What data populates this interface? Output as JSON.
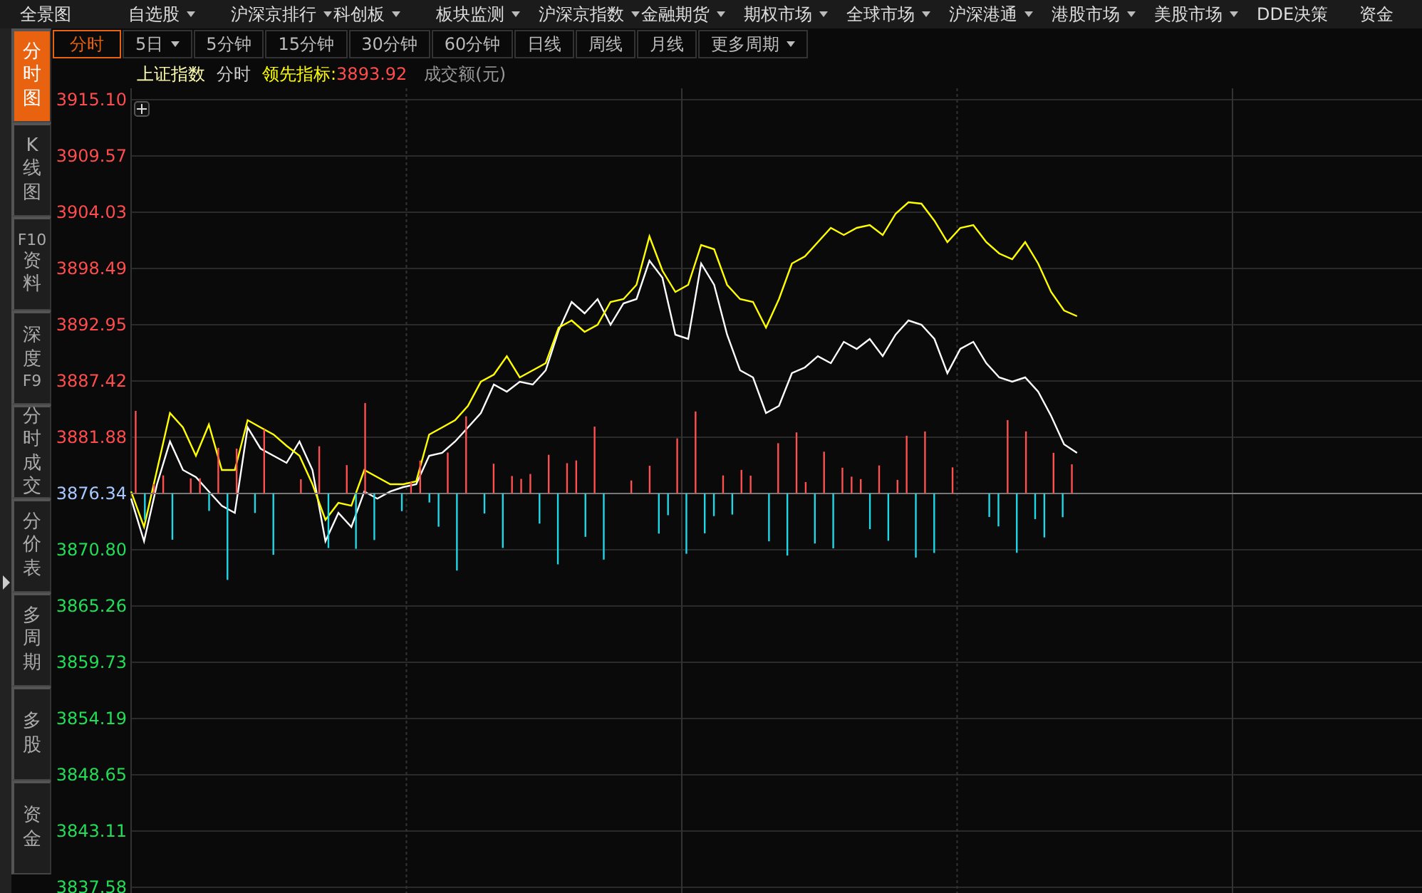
{
  "menu": [
    {
      "label": "全景图",
      "dropdown": false
    },
    {
      "label": "自选股",
      "dropdown": true
    },
    {
      "label": "沪深京排行",
      "dropdown": true
    },
    {
      "label": "科创板",
      "dropdown": true
    },
    {
      "label": "板块监测",
      "dropdown": true
    },
    {
      "label": "沪深京指数",
      "dropdown": true
    },
    {
      "label": "金融期货",
      "dropdown": true
    },
    {
      "label": "期权市场",
      "dropdown": true
    },
    {
      "label": "全球市场",
      "dropdown": true
    },
    {
      "label": "沪深港通",
      "dropdown": true
    },
    {
      "label": "港股市场",
      "dropdown": true
    },
    {
      "label": "美股市场",
      "dropdown": true
    },
    {
      "label": "DDE决策",
      "dropdown": false
    },
    {
      "label": "资金",
      "dropdown": false
    }
  ],
  "sidebar": [
    {
      "lines": [
        "分",
        "时",
        "图"
      ],
      "selected": true
    },
    {
      "lines": [
        "K",
        "线",
        "图"
      ],
      "selected": false
    },
    {
      "lines": [
        "F10",
        "资",
        "料"
      ],
      "selected": false
    },
    {
      "lines": [
        "深",
        "度",
        "F9"
      ],
      "selected": false
    },
    {
      "lines": [
        "分",
        "时",
        "成",
        "交"
      ],
      "selected": false
    },
    {
      "lines": [
        "分",
        "价",
        "表"
      ],
      "selected": false
    },
    {
      "lines": [
        "多",
        "周",
        "期"
      ],
      "selected": false
    },
    {
      "lines": [
        "多",
        "股"
      ],
      "selected": false
    },
    {
      "lines": [
        "资",
        "金"
      ],
      "selected": false
    }
  ],
  "periods": [
    {
      "label": "分时",
      "dropdown": false,
      "selected": true
    },
    {
      "label": "5日",
      "dropdown": true,
      "selected": false
    },
    {
      "label": "5分钟",
      "dropdown": false,
      "selected": false
    },
    {
      "label": "15分钟",
      "dropdown": false,
      "selected": false
    },
    {
      "label": "30分钟",
      "dropdown": false,
      "selected": false
    },
    {
      "label": "60分钟",
      "dropdown": false,
      "selected": false
    },
    {
      "label": "日线",
      "dropdown": false,
      "selected": false
    },
    {
      "label": "周线",
      "dropdown": false,
      "selected": false
    },
    {
      "label": "月线",
      "dropdown": false,
      "selected": false
    },
    {
      "label": "更多周期",
      "dropdown": true,
      "selected": false
    }
  ],
  "info": {
    "title": "上证指数",
    "period": "分时",
    "indicator_label": "领先指标:",
    "indicator_value": "3893.92",
    "volume_label": "成交额(元)"
  },
  "chart_data": {
    "type": "line",
    "grid": true,
    "ylim": [
      3837.58,
      3915.1
    ],
    "yticks": [
      {
        "value": 3915.1,
        "label": "3915.10"
      },
      {
        "value": 3909.57,
        "label": "3909.57"
      },
      {
        "value": 3904.03,
        "label": "3904.03"
      },
      {
        "value": 3898.49,
        "label": "3898.49"
      },
      {
        "value": 3892.95,
        "label": "3892.95"
      },
      {
        "value": 3887.42,
        "label": "3887.42"
      },
      {
        "value": 3881.88,
        "label": "3881.88"
      },
      {
        "value": 3876.34,
        "label": "3876.34"
      },
      {
        "value": 3870.8,
        "label": "3870.80"
      },
      {
        "value": 3865.26,
        "label": "3865.26"
      },
      {
        "value": 3859.73,
        "label": "3859.73"
      },
      {
        "value": 3854.19,
        "label": "3854.19"
      },
      {
        "value": 3848.65,
        "label": "3848.65"
      },
      {
        "value": 3843.11,
        "label": "3843.11"
      },
      {
        "value": 3837.58,
        "label": "3837.58"
      }
    ],
    "categories": [
      null,
      null,
      null,
      null,
      null,
      null,
      null,
      null,
      null,
      null,
      null,
      null,
      null,
      null,
      null,
      null,
      null,
      null,
      null,
      null,
      null,
      null,
      null,
      null,
      null,
      null,
      null,
      null,
      null,
      null,
      null,
      null,
      null,
      null,
      null,
      null,
      null,
      null,
      null,
      null,
      null,
      null,
      null,
      null,
      null,
      null,
      null,
      null,
      null,
      null,
      null,
      null,
      null,
      null,
      null,
      null,
      null,
      null,
      null,
      null,
      null,
      null,
      null,
      null,
      null,
      null,
      null,
      null,
      null,
      null,
      null,
      null,
      null,
      null,
      null,
      null,
      null,
      null,
      null,
      null,
      null,
      null,
      null,
      null,
      null,
      null
    ],
    "series": [
      {
        "color": "#ffffff",
        "values": [
          3875.84,
          3871.64,
          3877.25,
          3881.45,
          3878.65,
          3877.95,
          3876.54,
          3875.14,
          3874.44,
          3882.85,
          3880.75,
          3880.05,
          3879.35,
          3881.45,
          3878.65,
          3871.64,
          3874.44,
          3873.04,
          3876.54,
          3875.84,
          3876.54,
          3876.97,
          3877.25,
          3880.05,
          3880.33,
          3881.45,
          3882.85,
          3884.26,
          3887.06,
          3886.36,
          3887.34,
          3887.06,
          3888.46,
          3892.39,
          3895.19,
          3894.07,
          3895.47,
          3892.95,
          3895.05,
          3895.47,
          3899.26,
          3897.58,
          3891.97,
          3891.55,
          3898.98,
          3896.87,
          3891.97,
          3888.46,
          3887.76,
          3884.26,
          3884.96,
          3888.18,
          3888.74,
          3889.86,
          3889.16,
          3891.27,
          3890.57,
          3891.55,
          3889.86,
          3891.97,
          3893.37,
          3892.95,
          3891.55,
          3888.18,
          3890.57,
          3891.27,
          3889.16,
          3887.76,
          3887.34,
          3887.76,
          3886.36,
          3883.98,
          3881.17,
          3880.33,
          null,
          null,
          null,
          null,
          null,
          null,
          null,
          null,
          null,
          null,
          null,
          null
        ]
      },
      {
        "color": "#ffff00",
        "values": [
          3876.54,
          3873.04,
          3878.65,
          3884.26,
          3882.85,
          3880.05,
          3883.13,
          3878.65,
          3878.65,
          3883.56,
          3882.85,
          3882.15,
          3881.03,
          3880.05,
          3877.25,
          3873.74,
          3875.42,
          3875.14,
          3878.65,
          3877.95,
          3877.25,
          3877.25,
          3877.53,
          3882.15,
          3882.85,
          3883.56,
          3884.96,
          3887.34,
          3888.04,
          3889.86,
          3887.76,
          3888.46,
          3889.16,
          3892.67,
          3893.37,
          3892.25,
          3892.95,
          3895.19,
          3895.47,
          3896.87,
          3901.64,
          3898.28,
          3896.17,
          3896.87,
          3900.8,
          3900.38,
          3896.87,
          3895.47,
          3895.19,
          3892.67,
          3895.47,
          3898.98,
          3899.68,
          3901.08,
          3902.48,
          3901.78,
          3902.48,
          3902.76,
          3901.78,
          3903.88,
          3905.01,
          3904.87,
          3903.18,
          3901.08,
          3902.48,
          3902.76,
          3901.08,
          3899.96,
          3899.4,
          3901.08,
          3898.98,
          3896.17,
          3894.35,
          3893.79,
          null,
          null,
          null,
          null,
          null,
          null,
          null,
          null,
          null,
          null,
          null,
          null
        ]
      }
    ]
  }
}
